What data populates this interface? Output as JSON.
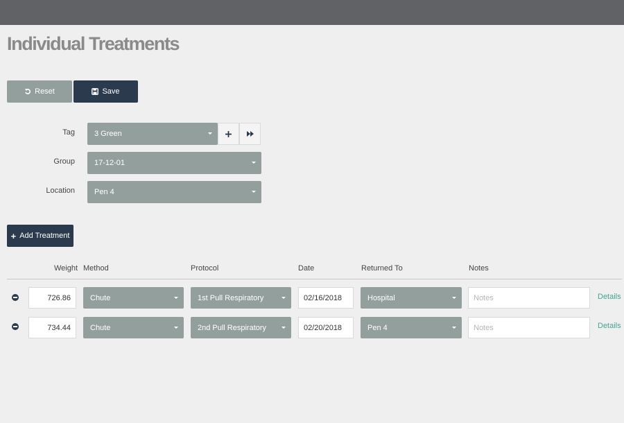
{
  "page": {
    "title": "Individual Treatments"
  },
  "toolbar": {
    "reset_label": "Reset",
    "save_label": "Save",
    "reset_icon": "undo-icon",
    "save_icon": "floppy-disk-icon"
  },
  "form": {
    "tag": {
      "label": "Tag",
      "value": "3 Green",
      "add_icon": "plus-icon",
      "next_icon": "fast-forward-icon"
    },
    "group": {
      "label": "Group",
      "value": "17-12-01"
    },
    "location": {
      "label": "Location",
      "value": "Pen 4"
    }
  },
  "add_treatment": {
    "label": "Add Treatment",
    "icon": "plus-icon"
  },
  "table": {
    "headers": {
      "weight": "Weight",
      "method": "Method",
      "protocol": "Protocol",
      "date": "Date",
      "returned_to": "Returned To",
      "notes": "Notes"
    },
    "rows": [
      {
        "weight": "726.86",
        "method": "Chute",
        "protocol": "1st Pull Respiratory",
        "date": "02/16/2018",
        "returned_to": "Hospital",
        "notes_placeholder": "Notes",
        "details": "Details"
      },
      {
        "weight": "734.44",
        "method": "Chute",
        "protocol": "2nd Pull Respiratory",
        "date": "02/20/2018",
        "returned_to": "Pen 4",
        "notes_placeholder": "Notes",
        "details": "Details"
      }
    ]
  },
  "colors": {
    "topbar": "#616266",
    "primary": "#2b3a4d",
    "select": "#939f9d",
    "link": "#3fa592",
    "background": "#efefef"
  }
}
